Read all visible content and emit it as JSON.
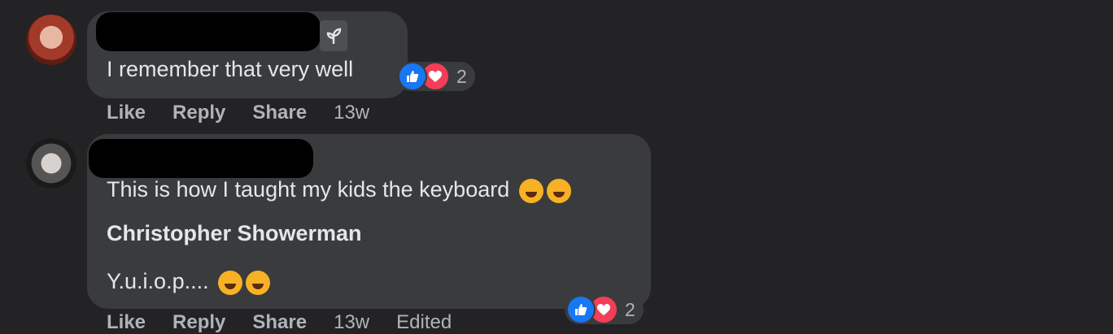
{
  "colors": {
    "background": "#232325",
    "bubble": "#3a3b3c",
    "like": "#1877f2",
    "love": "#f33e58",
    "text": "#e4e6eb",
    "secondary": "#b0b3b8"
  },
  "comments": [
    {
      "text": "I remember that very well",
      "reactions": {
        "icons": [
          "like-icon",
          "love-icon"
        ],
        "count": "2"
      },
      "actions": {
        "like": "Like",
        "reply": "Reply",
        "share": "Share",
        "time": "13w"
      }
    },
    {
      "text": "This is how I taught my kids the keyboard",
      "reply_name": "Christopher Showerman",
      "reply_text": "Y.u.i.o.p....",
      "reactions": {
        "icons": [
          "like-icon",
          "love-icon"
        ],
        "count": "2"
      },
      "actions": {
        "like": "Like",
        "reply": "Reply",
        "share": "Share",
        "time": "13w",
        "edited": "Edited"
      }
    }
  ]
}
